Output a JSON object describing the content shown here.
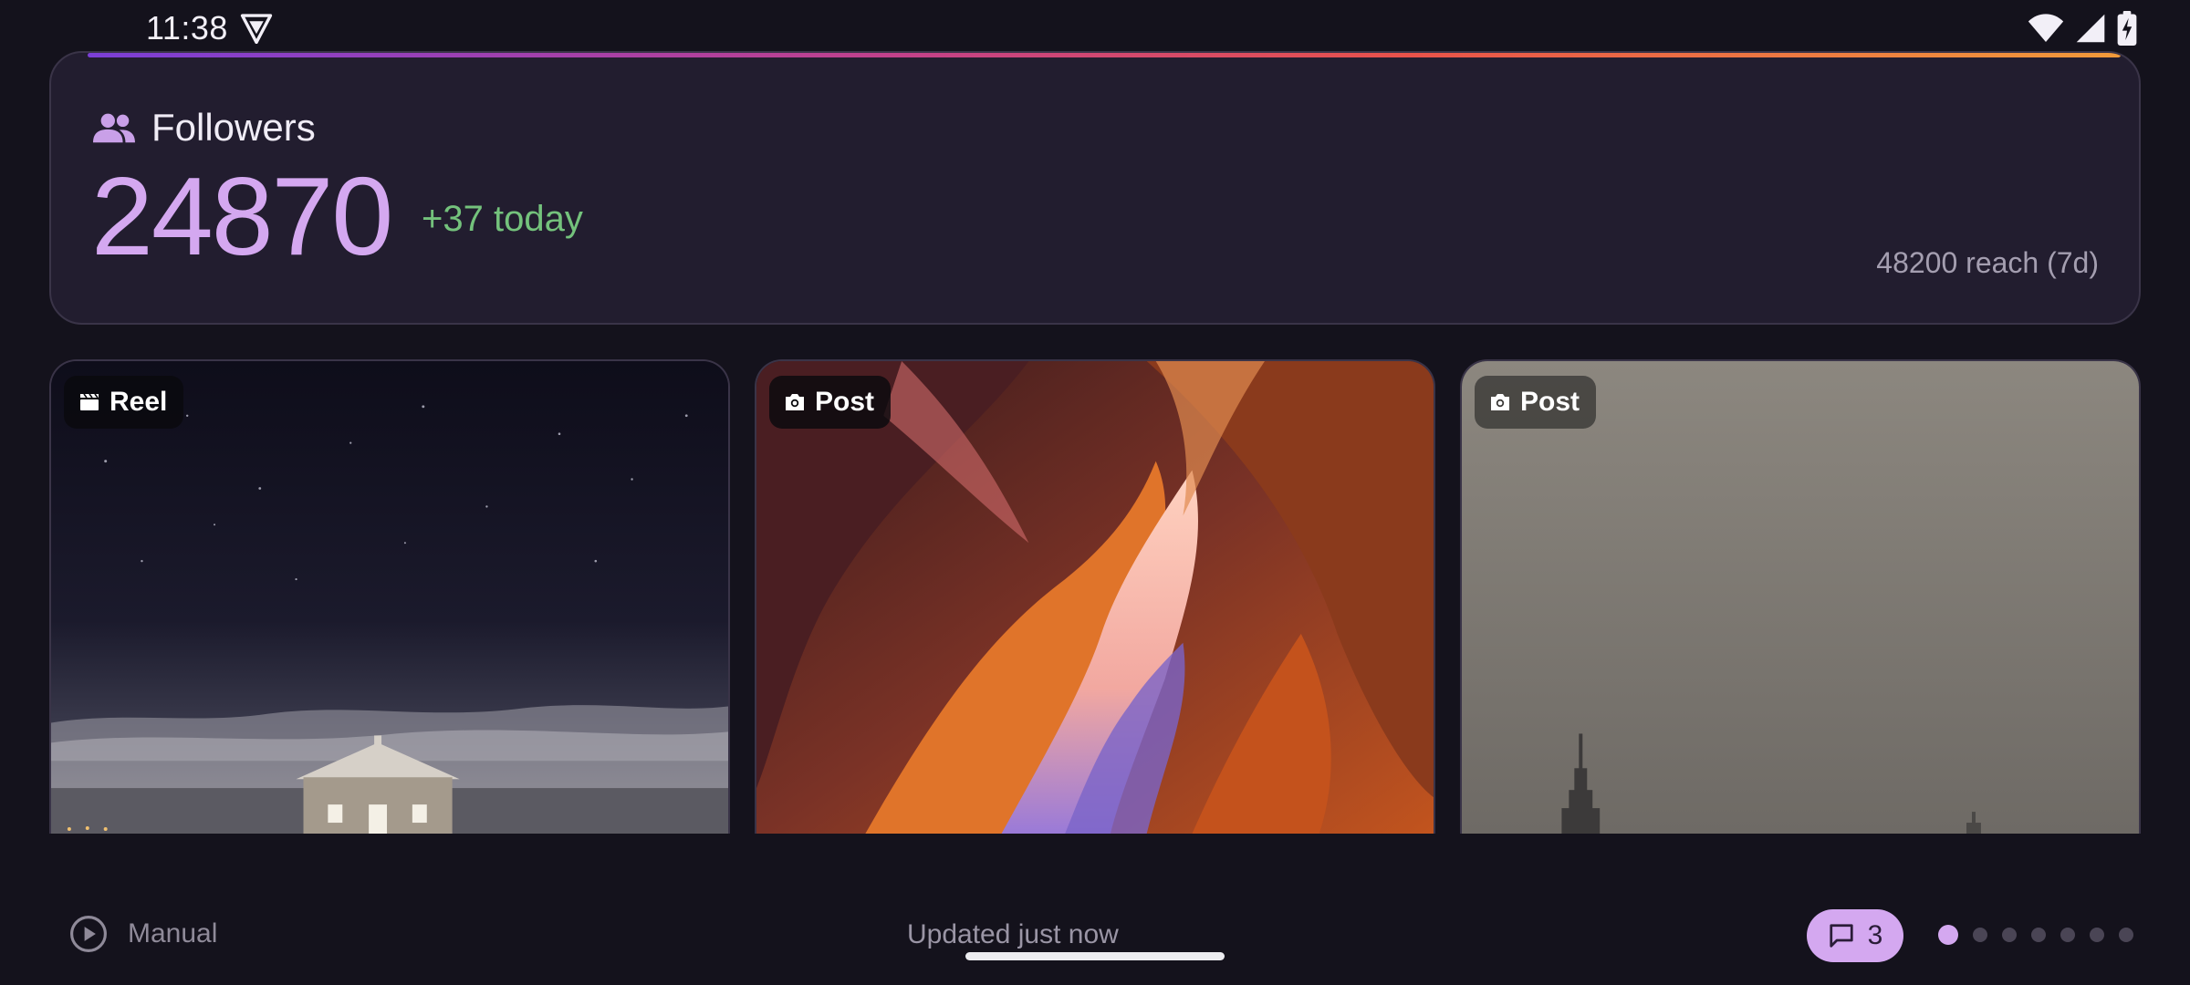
{
  "status_bar": {
    "time": "11:38",
    "icons": [
      "vpn-shield-icon",
      "wifi-icon",
      "cell-signal-icon",
      "battery-charging-icon"
    ]
  },
  "followers_card": {
    "icon": "people-icon",
    "title": "Followers",
    "count": "24870",
    "delta": "+37 today",
    "reach": "48200 reach (7d)",
    "colors": {
      "count": "#d4a8f0",
      "delta": "#74c27c",
      "accent_start": "#7b3fd6",
      "accent_end": "#f19a3a"
    }
  },
  "tiles": [
    {
      "type_label": "Reel",
      "icon": "clapperboard-icon",
      "scene": "night sky over a small house"
    },
    {
      "type_label": "Post",
      "icon": "camera-icon",
      "scene": "sandstone slot canyon"
    },
    {
      "type_label": "Post",
      "icon": "camera-icon",
      "scene": "hazy city skyline"
    }
  ],
  "footer": {
    "mode_icon": "play-circle-icon",
    "mode_label": "Manual",
    "updated": "Updated just now",
    "comments_icon": "comment-icon",
    "comments_count": "3",
    "pages_total": 7,
    "active_page": 1
  }
}
